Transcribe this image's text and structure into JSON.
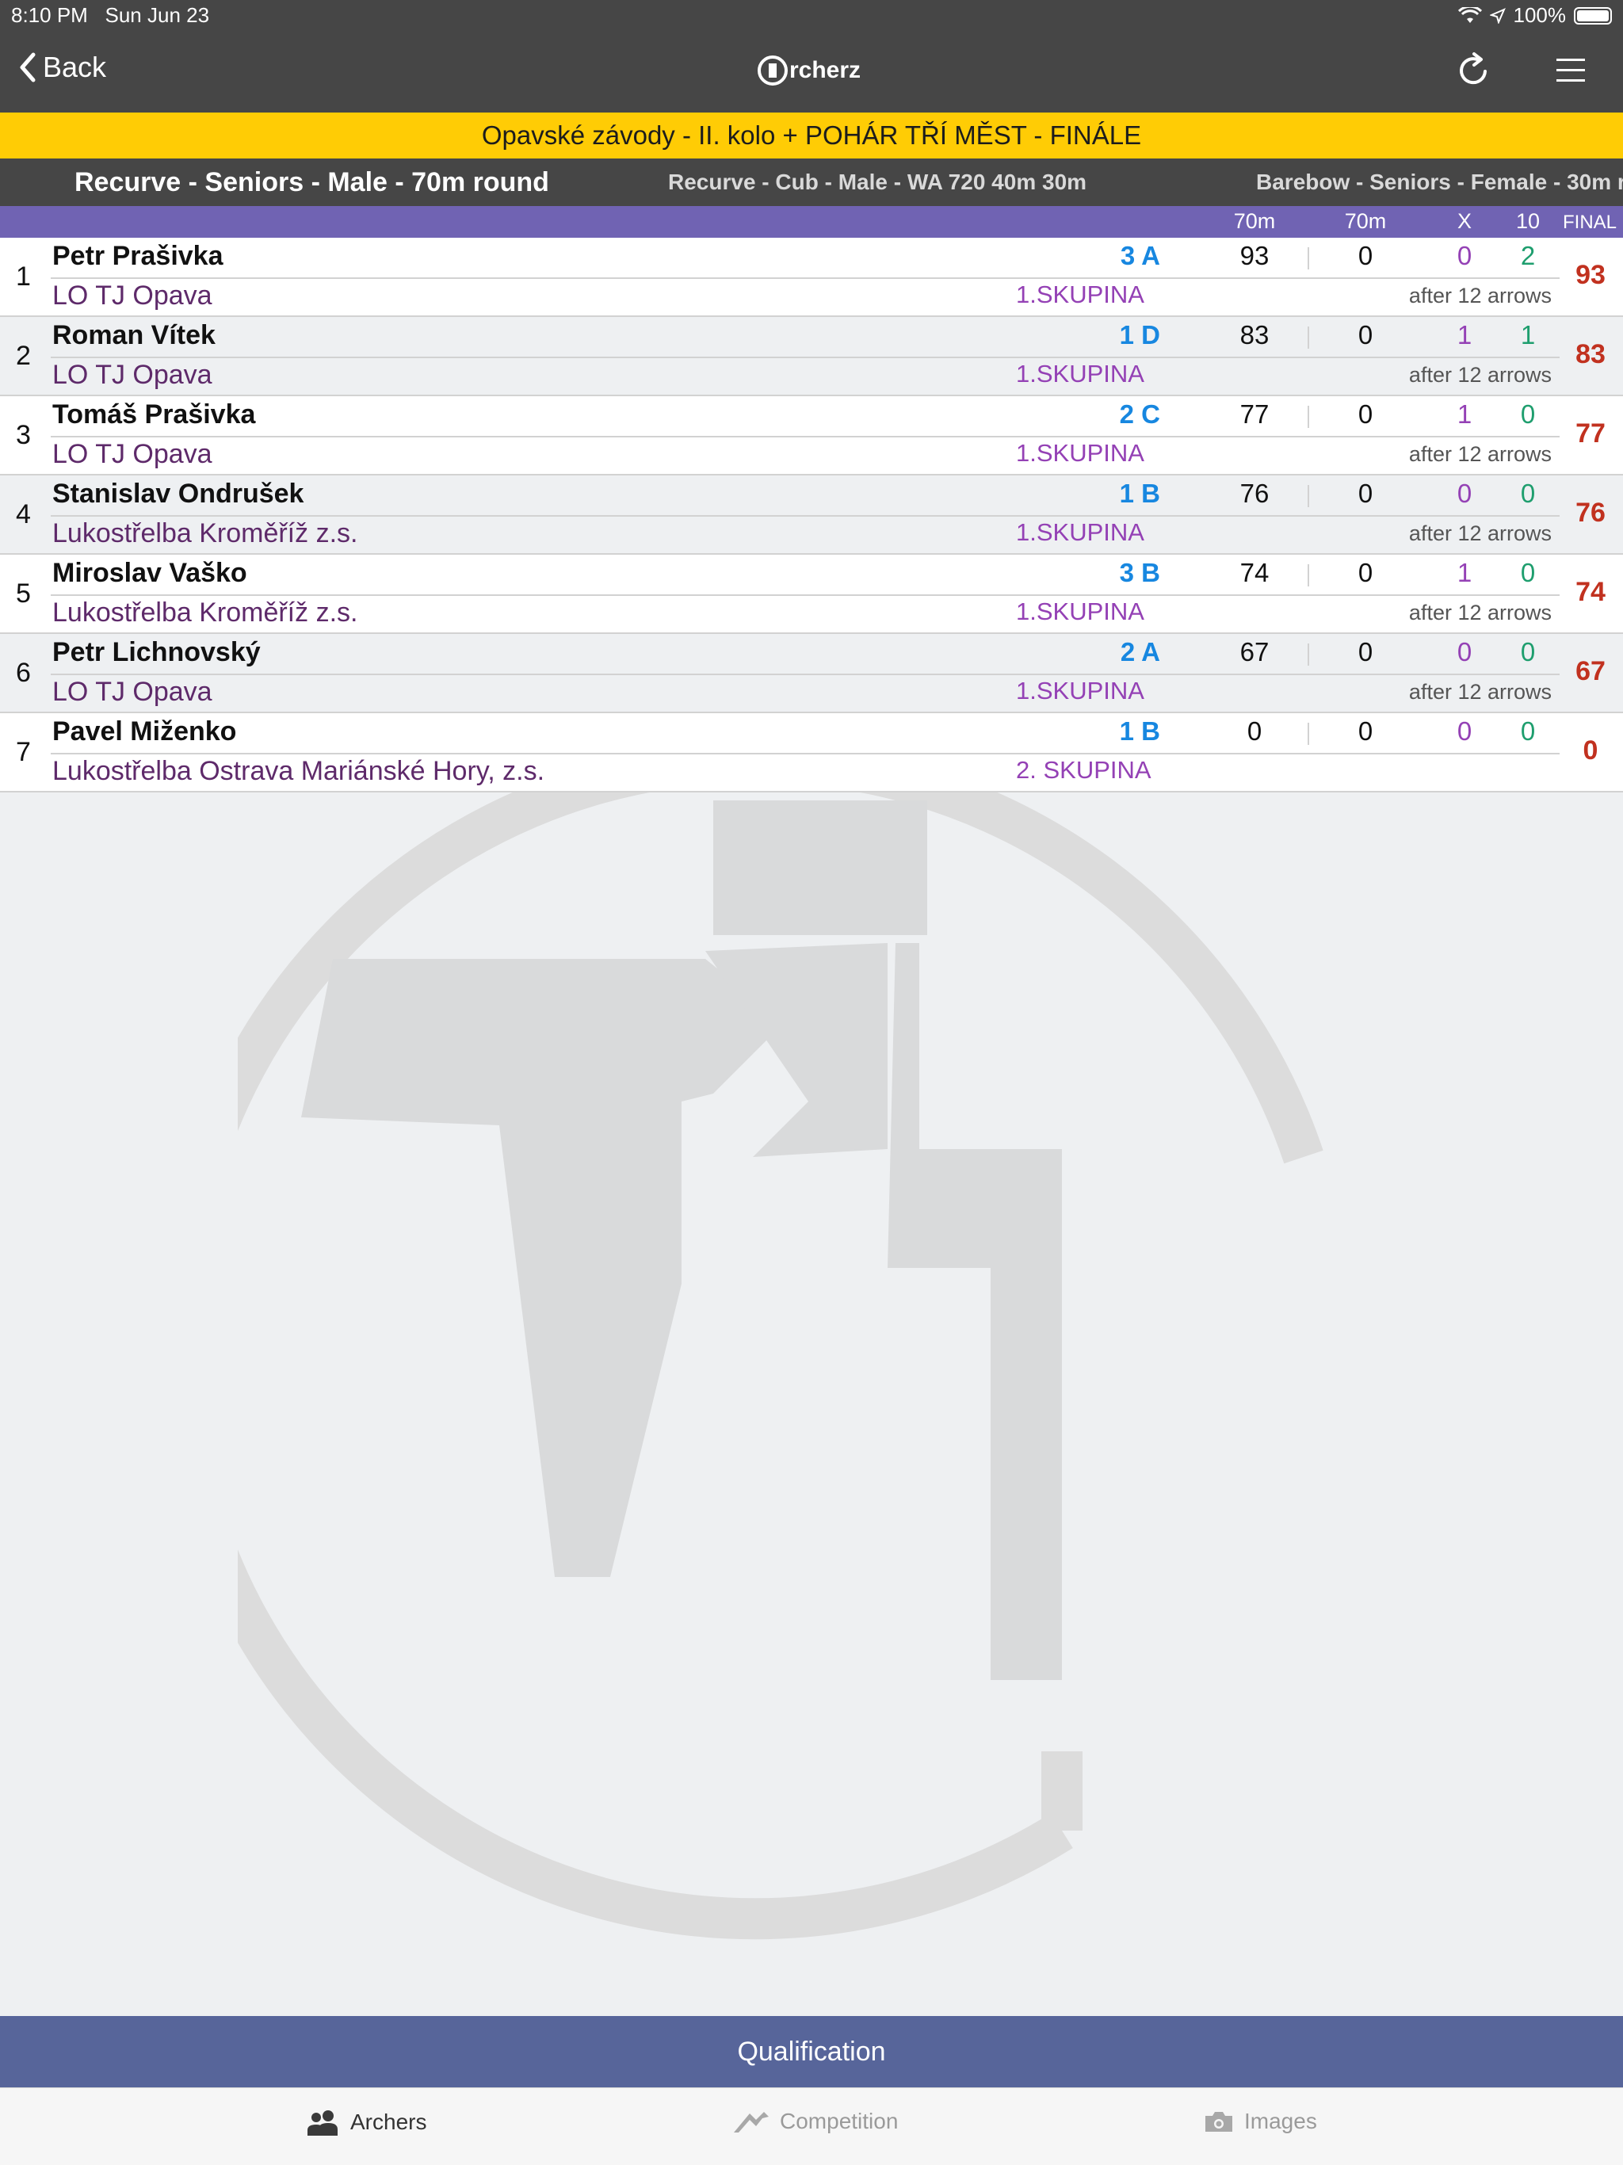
{
  "status_bar": {
    "time": "8:10 PM",
    "date": "Sun Jun 23",
    "battery": "100%"
  },
  "nav": {
    "back_label": "Back",
    "logo_text": "rcherz"
  },
  "event": {
    "title": "Opavské závody - II. kolo + POHÁR TŘÍ MĚST - FINÁLE"
  },
  "categories": [
    {
      "label": "Recurve - Seniors - Male - 70m round",
      "active": true
    },
    {
      "label": "Recurve - Cub - Male - WA 720 40m 30m",
      "active": false
    },
    {
      "label": "Barebow - Seniors - Female - 30m r",
      "active": false
    }
  ],
  "columns": {
    "d1": "70m",
    "d2": "70m",
    "x": "X",
    "ten": "10",
    "final": "FINAL"
  },
  "results": [
    {
      "rank": "1",
      "name": "Petr Prašivka",
      "club": "LO TJ Opava",
      "target": "3 A",
      "group": "1.SKUPINA",
      "score1": "93",
      "score2": "0",
      "x": "0",
      "ten": "2",
      "after": "after 12 arrows",
      "final": "93"
    },
    {
      "rank": "2",
      "name": "Roman Vítek",
      "club": "LO TJ Opava",
      "target": "1 D",
      "group": "1.SKUPINA",
      "score1": "83",
      "score2": "0",
      "x": "1",
      "ten": "1",
      "after": "after 12 arrows",
      "final": "83"
    },
    {
      "rank": "3",
      "name": "Tomáš Prašivka",
      "club": "LO TJ Opava",
      "target": "2 C",
      "group": "1.SKUPINA",
      "score1": "77",
      "score2": "0",
      "x": "1",
      "ten": "0",
      "after": "after 12 arrows",
      "final": "77"
    },
    {
      "rank": "4",
      "name": "Stanislav Ondrušek",
      "club": "Lukostřelba Kroměříž z.s.",
      "target": "1 B",
      "group": "1.SKUPINA",
      "score1": "76",
      "score2": "0",
      "x": "0",
      "ten": "0",
      "after": "after 12 arrows",
      "final": "76"
    },
    {
      "rank": "5",
      "name": "Miroslav Vaško",
      "club": "Lukostřelba Kroměříž z.s.",
      "target": "3 B",
      "group": "1.SKUPINA",
      "score1": "74",
      "score2": "0",
      "x": "1",
      "ten": "0",
      "after": "after 12 arrows",
      "final": "74"
    },
    {
      "rank": "6",
      "name": "Petr Lichnovský",
      "club": "LO TJ Opava",
      "target": "2 A",
      "group": "1.SKUPINA",
      "score1": "67",
      "score2": "0",
      "x": "0",
      "ten": "0",
      "after": "after 12 arrows",
      "final": "67"
    },
    {
      "rank": "7",
      "name": "Pavel Miženko",
      "club": "Lukostřelba Ostrava Mariánské Hory, z.s.",
      "target": "1 B",
      "group": "2. SKUPINA",
      "score1": "0",
      "score2": "0",
      "x": "0",
      "ten": "0",
      "after": "",
      "final": "0"
    }
  ],
  "phase": {
    "label": "Qualification"
  },
  "tabs": [
    {
      "label": "Archers",
      "icon": "archers-icon",
      "active": true
    },
    {
      "label": "Competition",
      "icon": "competition-icon",
      "active": false
    },
    {
      "label": "Images",
      "icon": "camera-icon",
      "active": false
    }
  ],
  "colors": {
    "accent_yellow": "#ffcc05",
    "header_purple": "#7063b3",
    "phase_bar": "#57659a",
    "final_red": "#c1311f",
    "target_blue": "#1787e0"
  }
}
